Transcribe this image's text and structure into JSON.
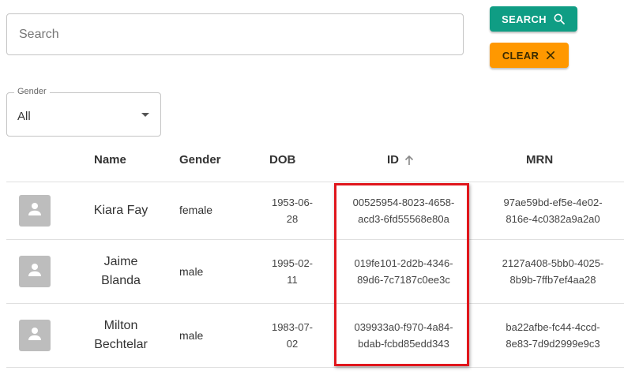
{
  "search": {
    "placeholder": "Search",
    "value": ""
  },
  "buttons": {
    "search_label": "SEARCH",
    "clear_label": "CLEAR"
  },
  "colors": {
    "search_button": "#0f9d84",
    "clear_button": "#ff9800",
    "highlight": "#e0161c"
  },
  "filter": {
    "gender_label": "Gender",
    "gender_value": "All"
  },
  "table": {
    "headers": {
      "name": "Name",
      "gender": "Gender",
      "dob": "DOB",
      "id": "ID",
      "mrn": "MRN"
    },
    "sort": {
      "column": "ID",
      "direction": "ascending",
      "icon": "arrow-up-icon"
    },
    "rows": [
      {
        "name_line1": "Kiara Fay",
        "name_line2": "",
        "gender": "female",
        "dob_line1": "1953-06-",
        "dob_line2": "28",
        "id_line1": "00525954-8023-4658-",
        "id_line2": "acd3-6fd55568e80a",
        "mrn_line1": "97ae59bd-ef5e-4e02-",
        "mrn_line2": "816e-4c0382a9a2a0"
      },
      {
        "name_line1": "Jaime",
        "name_line2": "Blanda",
        "gender": "male",
        "dob_line1": "1995-02-",
        "dob_line2": "11",
        "id_line1": "019fe101-2d2b-4346-",
        "id_line2": "89d6-7c7187c0ee3c",
        "mrn_line1": "2127a408-5bb0-4025-",
        "mrn_line2": "8b9b-7ffb7ef4aa28"
      },
      {
        "name_line1": "Milton",
        "name_line2": "Bechtelar",
        "gender": "male",
        "dob_line1": "1983-07-",
        "dob_line2": "02",
        "id_line1": "039933a0-f970-4a84-",
        "id_line2": "bdab-fcbd85edd343",
        "mrn_line1": "ba22afbe-fc44-4ccd-",
        "mrn_line2": "8e83-7d9d2999e9c3"
      }
    ]
  }
}
